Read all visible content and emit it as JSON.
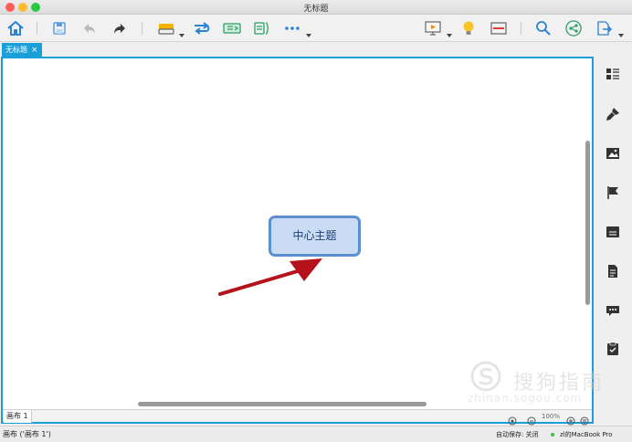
{
  "window": {
    "title": "无标题",
    "traffic_lights": {
      "close": "#fe5f57",
      "minimize": "#febc2e",
      "zoom": "#28c840"
    }
  },
  "toolbar": {
    "icons": [
      "home-icon",
      "save-icon",
      "undo-icon",
      "redo-icon",
      "insert-topic-icon",
      "relationship-icon",
      "summary-icon",
      "boundary-icon",
      "more-icon",
      "presentation-icon",
      "idea-icon",
      "outline-icon",
      "search-icon",
      "share-icon",
      "export-icon"
    ]
  },
  "tabs": [
    {
      "label": "无标题",
      "close": "×"
    }
  ],
  "canvas": {
    "central_topic": "中心主题",
    "arrow_color": "#b5121b",
    "accent": "#1a9fd8"
  },
  "sheets": {
    "active": "画布 1",
    "zoom": "100%"
  },
  "sidebar": {
    "icons": [
      "format-icon",
      "style-brush-icon",
      "image-icon",
      "marker-flag-icon",
      "text-icon",
      "notes-icon",
      "comment-icon",
      "task-icon"
    ]
  },
  "status": {
    "sheet": "画布 ('画布 1')",
    "autosave": "自动保存: 关闭",
    "device": "zl的MacBook Pro"
  },
  "watermark": {
    "text": "搜狗指南",
    "url": "zhinan.sogou.com"
  }
}
